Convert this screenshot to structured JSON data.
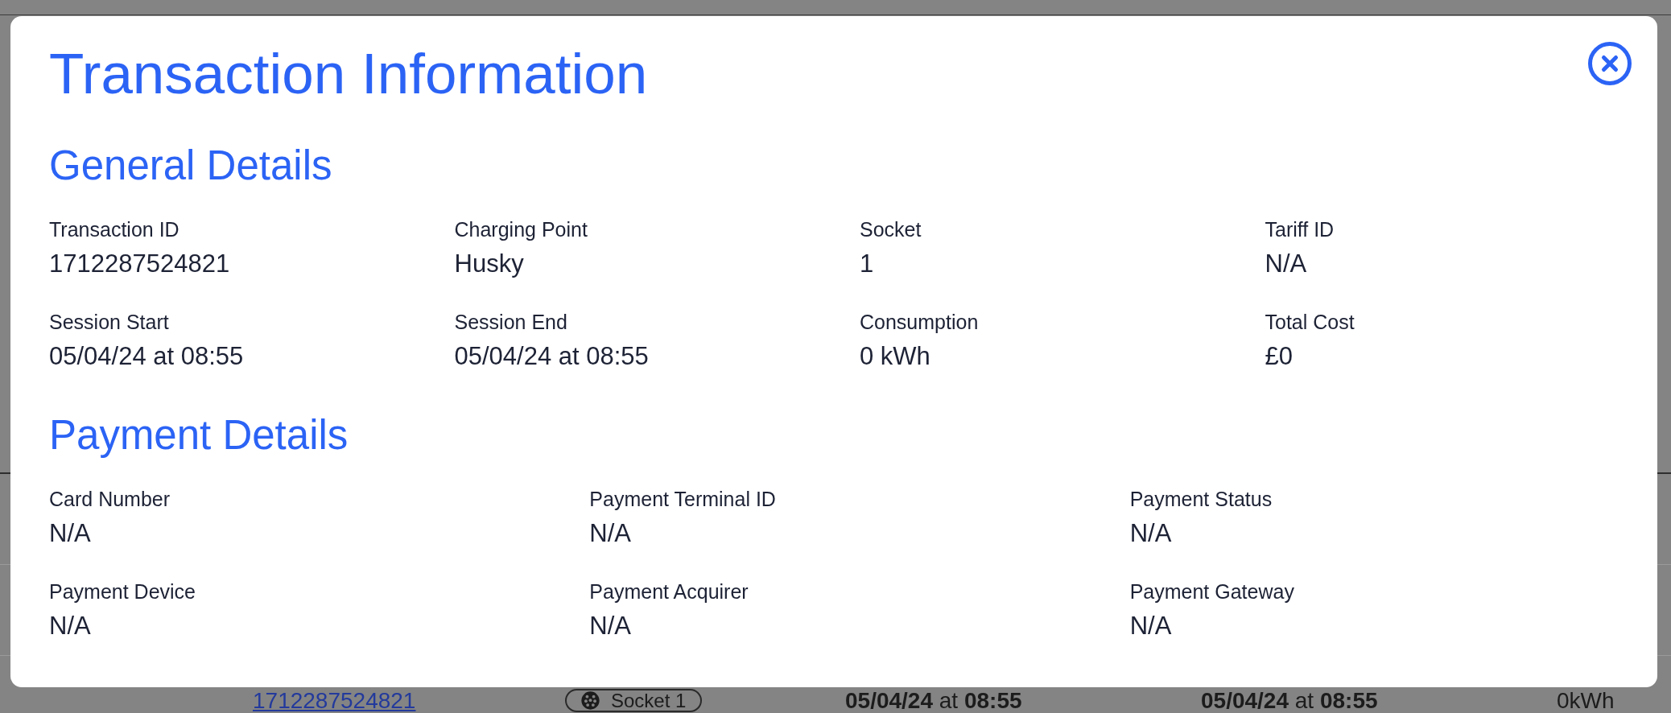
{
  "background_table_row": {
    "cells": [
      {
        "kind": "link",
        "text": "1712287524821"
      },
      {
        "kind": "socket",
        "text": "Socket 1"
      },
      {
        "kind": "datetime",
        "text": "**05/04/24** at **08:55**"
      },
      {
        "kind": "datetime",
        "text": "**05/04/24** at **08:55**"
      },
      {
        "kind": "text",
        "text": "0kWh"
      }
    ]
  },
  "modal": {
    "title": "Transaction Information",
    "sections": [
      {
        "heading": "General Details",
        "rows": [
          [
            {
              "label": "Transaction ID",
              "value": "1712287524821"
            },
            {
              "label": "Charging Point",
              "value": "Husky"
            },
            {
              "label": "Socket",
              "value": "1"
            },
            {
              "label": "Tariff ID",
              "value": "N/A"
            }
          ],
          [
            {
              "label": "Session Start",
              "value": "05/04/24 at 08:55"
            },
            {
              "label": "Session End",
              "value": "05/04/24 at 08:55"
            },
            {
              "label": "Consumption",
              "value": "0 kWh"
            },
            {
              "label": "Total Cost",
              "value": "£0"
            }
          ]
        ]
      },
      {
        "heading": "Payment Details",
        "rows": [
          [
            {
              "label": "Card Number",
              "value": "N/A"
            },
            {
              "label": "Payment Terminal ID",
              "value": "N/A"
            },
            {
              "label": "Payment Status",
              "value": "N/A"
            }
          ],
          [
            {
              "label": "Payment Device",
              "value": "N/A"
            },
            {
              "label": "Payment Acquirer",
              "value": "N/A"
            },
            {
              "label": "Payment Gateway",
              "value": "N/A"
            }
          ]
        ]
      }
    ]
  }
}
